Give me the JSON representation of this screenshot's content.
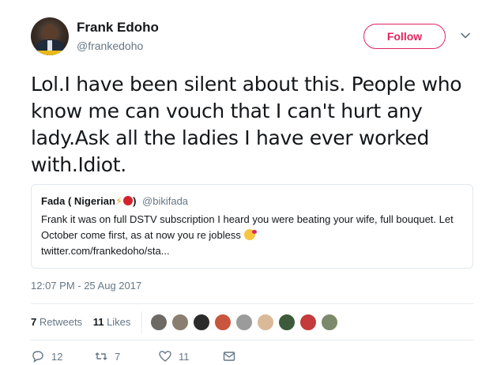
{
  "author": {
    "name": "Frank Edoho",
    "handle": "@frankedoho",
    "avatar_icon": "profile-photo"
  },
  "follow_label": "Follow",
  "tweet_text": "Lol.I have been silent about this. People who know me can vouch that I can't hurt any lady.Ask all the ladies I have ever worked with.Idiot.",
  "quoted_tweet": {
    "name": "Fada ( Nigerian",
    "name_close": ")",
    "handle": "@bikifada",
    "text": "Frank it was on full DSTV subscription I heard you were beating your wife, full bouquet. Let October come first, as at now you re jobless",
    "link": "twitter.com/frankedoho/sta..."
  },
  "timestamp": "12:07 PM - 25 Aug 2017",
  "stats": {
    "retweets_count": "7",
    "retweets_label": "Retweets",
    "likes_count": "11",
    "likes_label": "Likes"
  },
  "likers": [
    {
      "color": "#6d6a66"
    },
    {
      "color": "#8a7e70"
    },
    {
      "color": "#2b2b2b"
    },
    {
      "color": "#c8553d"
    },
    {
      "color": "#9b9b9b"
    },
    {
      "color": "#d9b998"
    },
    {
      "color": "#3d5a3a"
    },
    {
      "color": "#c43b3b"
    },
    {
      "color": "#7c8a6b"
    }
  ],
  "actions": {
    "reply_count": "12",
    "retweet_count": "7",
    "like_count": "11"
  },
  "colors": {
    "accent": "#e0245e",
    "secondary_text": "#657786",
    "primary_text": "#14171a"
  }
}
